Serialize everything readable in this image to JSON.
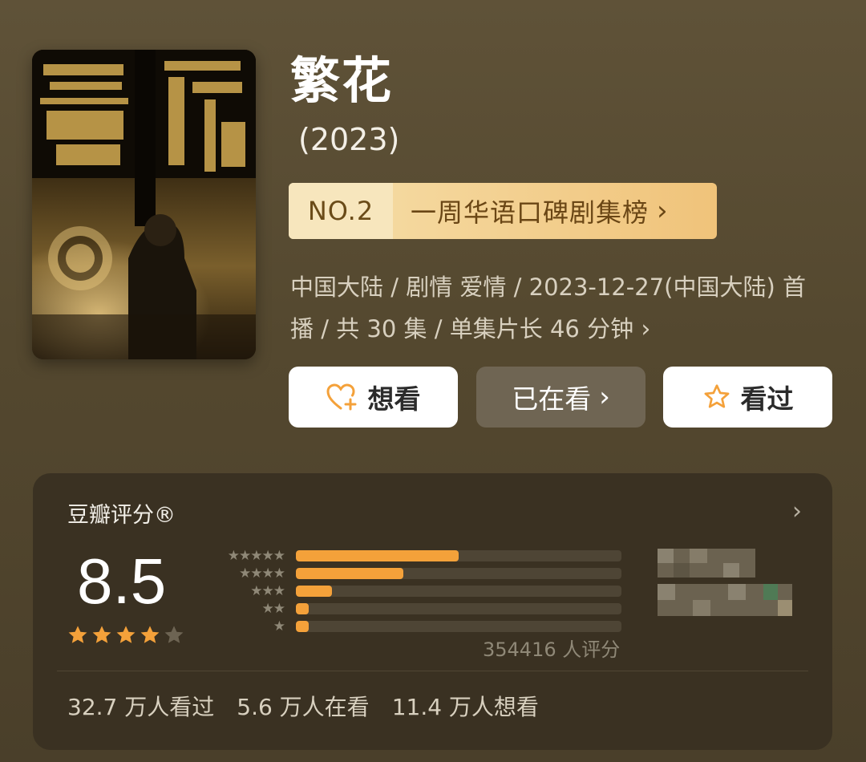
{
  "show": {
    "title": "繁花",
    "year": "(2023)",
    "rank": {
      "no": "NO.2",
      "label": "一周华语口碑剧集榜"
    },
    "meta_line1": "中国大陆 / 剧情 爱情 / 2023-12-27(中国大陆) 首",
    "meta_line2": "播 / 共 30 集 / 单集片长 46 分钟"
  },
  "actions": {
    "want": "想看",
    "watching": "已在看",
    "watched": "看过"
  },
  "rating": {
    "title": "豆瓣评分®",
    "score": "8.5",
    "stars": 4.5,
    "distribution": [
      {
        "stars": 5,
        "percent": 50
      },
      {
        "stars": 4,
        "percent": 33
      },
      {
        "stars": 3,
        "percent": 11
      },
      {
        "stars": 2,
        "percent": 4
      },
      {
        "stars": 1,
        "percent": 4
      }
    ],
    "count_text": "354416 人评分"
  },
  "stats": {
    "watched": "32.7 万人看过",
    "watching": "5.6 万人在看",
    "want": "11.4 万人想看"
  },
  "colors": {
    "accent": "#f4a13a",
    "background": "#54482f",
    "card": "#3a3122"
  }
}
